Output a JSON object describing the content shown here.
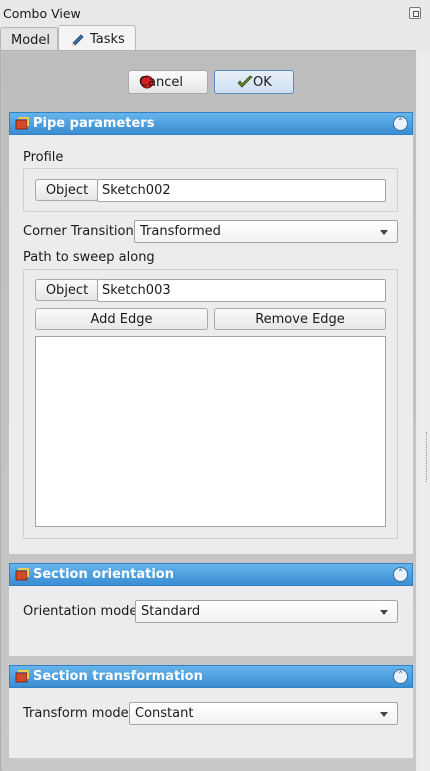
{
  "window": {
    "title": "Combo View"
  },
  "tabs": [
    {
      "label": "Model"
    },
    {
      "label": "Tasks"
    }
  ],
  "dialog": {
    "cancel_label": "Cancel",
    "ok_label": "OK"
  },
  "pipe_parameters": {
    "title": "Pipe parameters",
    "profile_label": "Profile",
    "profile_object_button": "Object",
    "profile_value": "Sketch002",
    "corner_transition_label": "Corner Transition",
    "corner_transition_value": "Transformed",
    "path_label": "Path to sweep along",
    "path_object_button": "Object",
    "path_value": "Sketch003",
    "add_edge_label": "Add Edge",
    "remove_edge_label": "Remove Edge"
  },
  "section_orientation": {
    "title": "Section orientation",
    "orientation_mode_label": "Orientation mode",
    "orientation_mode_value": "Standard"
  },
  "section_transformation": {
    "title": "Section transformation",
    "transform_mode_label": "Transform mode",
    "transform_mode_value": "Constant"
  },
  "colors": {
    "header_blue": "#3a8dd2",
    "accent": "#5a8bc1"
  },
  "icons": [
    "float-icon",
    "pencil-icon",
    "cancel-icon",
    "ok-icon",
    "pipe-icon",
    "collapse-icon",
    "dropdown-arrow-icon"
  ]
}
